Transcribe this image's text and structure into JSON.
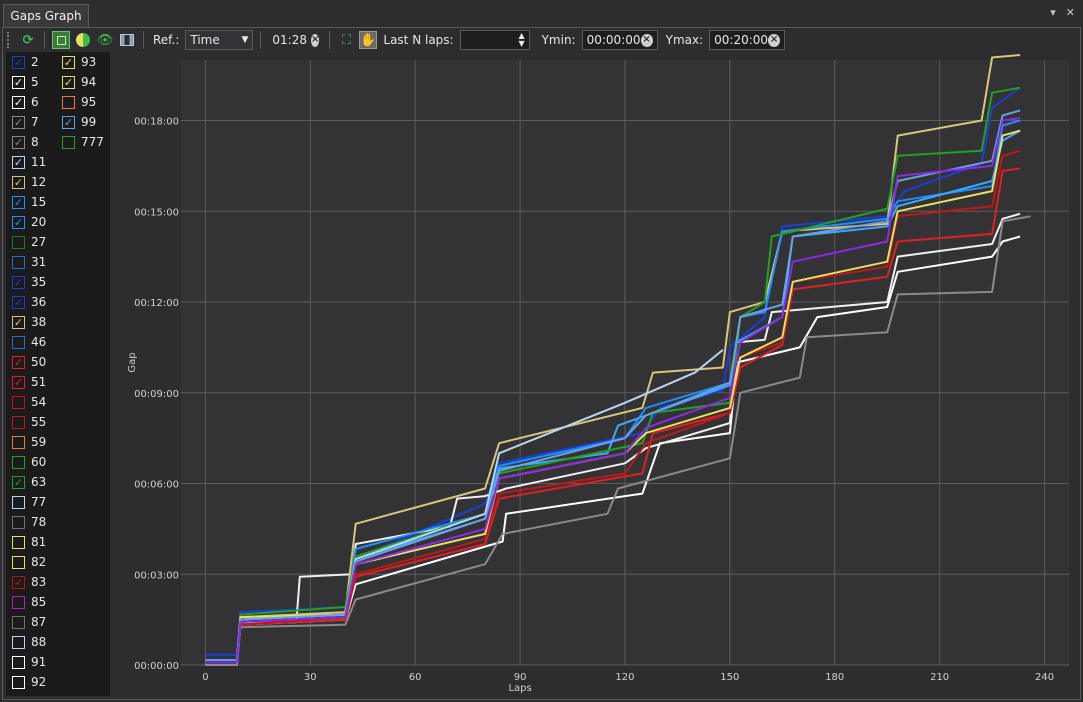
{
  "tab": {
    "title": "Gaps Graph"
  },
  "toolbar": {
    "ref_label": "Ref.:",
    "ref_value": "Time",
    "time_value": "01:28",
    "lastn_label": "Last N laps:",
    "lastn_value": "",
    "ymin_label": "Ymin:",
    "ymin_value": "00:00:00",
    "ymax_label": "Ymax:",
    "ymax_value": "00:20:00"
  },
  "drivers_col1": [
    {
      "num": "2",
      "color": "#1a3fd6",
      "checked": true
    },
    {
      "num": "5",
      "color": "#ffffff",
      "checked": true
    },
    {
      "num": "6",
      "color": "#ffffff",
      "checked": true
    },
    {
      "num": "7",
      "color": "#8a8a8a",
      "checked": true
    },
    {
      "num": "8",
      "color": "#8a8a8a",
      "checked": true
    },
    {
      "num": "11",
      "color": "#b9d6f2",
      "checked": true
    },
    {
      "num": "12",
      "color": "#d9c67a",
      "checked": true
    },
    {
      "num": "15",
      "color": "#1e90ff",
      "checked": true
    },
    {
      "num": "20",
      "color": "#1e90ff",
      "checked": true
    },
    {
      "num": "27",
      "color": "#1e7a1e",
      "checked": false
    },
    {
      "num": "31",
      "color": "#1e6fd0",
      "checked": false
    },
    {
      "num": "35",
      "color": "#1a3fd6",
      "checked": true
    },
    {
      "num": "36",
      "color": "#1a3fd6",
      "checked": true
    },
    {
      "num": "38",
      "color": "#d9c67a",
      "checked": true
    },
    {
      "num": "46",
      "color": "#1e6fd0",
      "checked": false
    },
    {
      "num": "50",
      "color": "#e02020",
      "checked": true
    },
    {
      "num": "51",
      "color": "#e02020",
      "checked": true
    },
    {
      "num": "54",
      "color": "#c01818",
      "checked": false
    },
    {
      "num": "55",
      "color": "#c01818",
      "checked": false
    },
    {
      "num": "59",
      "color": "#e87a3a",
      "checked": false
    },
    {
      "num": "60",
      "color": "#22a022",
      "checked": false
    },
    {
      "num": "63",
      "color": "#22a022",
      "checked": true
    },
    {
      "num": "77",
      "color": "#b9d6f2",
      "checked": false
    },
    {
      "num": "78",
      "color": "#707070",
      "checked": false
    },
    {
      "num": "81",
      "color": "#e8e060",
      "checked": false
    },
    {
      "num": "82",
      "color": "#e8e060",
      "checked": false
    },
    {
      "num": "83",
      "color": "#b01818",
      "checked": true
    },
    {
      "num": "85",
      "color": "#b020c0",
      "checked": false
    },
    {
      "num": "87",
      "color": "#707070",
      "checked": false
    },
    {
      "num": "88",
      "color": "#b9d6f2",
      "checked": false
    },
    {
      "num": "91",
      "color": "#ffffff",
      "checked": false
    },
    {
      "num": "92",
      "color": "#ffffff",
      "checked": false
    }
  ],
  "drivers_col2": [
    {
      "num": "93",
      "color": "#e8e060",
      "checked": true
    },
    {
      "num": "94",
      "color": "#e8e060",
      "checked": true
    },
    {
      "num": "95",
      "color": "#e87a3a",
      "checked": false
    },
    {
      "num": "99",
      "color": "#6aa0e0",
      "checked": true
    },
    {
      "num": "777",
      "color": "#22a022",
      "checked": false
    }
  ],
  "chart_data": {
    "type": "line",
    "xlabel": "Laps",
    "ylabel": "Gap",
    "xlim": [
      -27,
      247
    ],
    "ylim": [
      0,
      1200
    ],
    "xticks": [
      0,
      30,
      60,
      90,
      120,
      150,
      180,
      210,
      240
    ],
    "yticks": [
      0,
      180,
      360,
      540,
      720,
      900,
      1080
    ],
    "ytick_labels": [
      "00:00:00",
      "00:03:00",
      "00:06:00",
      "00:09:00",
      "00:12:00",
      "00:15:00",
      "00:18:00"
    ],
    "grid": true,
    "series": [
      {
        "color": "#1a3fd6",
        "values": [
          [
            0,
            20
          ],
          [
            9,
            20
          ],
          [
            10,
            105
          ],
          [
            40,
            115
          ],
          [
            43,
            210
          ],
          [
            80,
            320
          ],
          [
            84,
            400
          ],
          [
            125,
            460
          ],
          [
            130,
            510
          ],
          [
            148,
            545
          ],
          [
            150,
            630
          ],
          [
            160,
            690
          ],
          [
            165,
            870
          ],
          [
            195,
            890
          ],
          [
            200,
            940
          ],
          [
            222,
            995
          ],
          [
            225,
            1105
          ],
          [
            233,
            1145
          ]
        ]
      },
      {
        "color": "#ffffff",
        "values": [
          [
            0,
            0
          ],
          [
            9,
            0
          ],
          [
            10,
            80
          ],
          [
            40,
            90
          ],
          [
            43,
            160
          ],
          [
            85,
            245
          ],
          [
            86,
            300
          ],
          [
            125,
            340
          ],
          [
            130,
            440
          ],
          [
            150,
            460
          ],
          [
            152,
            600
          ],
          [
            170,
            630
          ],
          [
            175,
            690
          ],
          [
            195,
            710
          ],
          [
            198,
            780
          ],
          [
            225,
            810
          ],
          [
            228,
            840
          ],
          [
            233,
            850
          ]
        ]
      },
      {
        "color": "#f0f0f0",
        "values": [
          [
            0,
            0
          ],
          [
            9,
            0
          ],
          [
            10,
            85
          ],
          [
            26,
            85
          ],
          [
            27,
            175
          ],
          [
            42,
            180
          ],
          [
            43,
            240
          ],
          [
            70,
            275
          ],
          [
            72,
            330
          ],
          [
            80,
            335
          ],
          [
            86,
            350
          ],
          [
            120,
            400
          ],
          [
            126,
            430
          ],
          [
            150,
            480
          ],
          [
            152,
            640
          ],
          [
            160,
            645
          ],
          [
            162,
            700
          ],
          [
            195,
            720
          ],
          [
            198,
            810
          ],
          [
            225,
            835
          ],
          [
            228,
            885
          ],
          [
            233,
            895
          ]
        ]
      },
      {
        "color": "#8a8a8a",
        "values": [
          [
            0,
            0
          ],
          [
            9,
            0
          ],
          [
            10,
            75
          ],
          [
            40,
            80
          ],
          [
            43,
            130
          ],
          [
            80,
            200
          ],
          [
            85,
            260
          ],
          [
            115,
            300
          ],
          [
            118,
            350
          ],
          [
            150,
            410
          ],
          [
            153,
            540
          ],
          [
            170,
            570
          ],
          [
            172,
            650
          ],
          [
            195,
            660
          ],
          [
            198,
            735
          ],
          [
            225,
            740
          ],
          [
            228,
            880
          ],
          [
            236,
            890
          ]
        ]
      },
      {
        "color": "#d9c67a",
        "values": [
          [
            0,
            5
          ],
          [
            9,
            5
          ],
          [
            10,
            95
          ],
          [
            40,
            105
          ],
          [
            43,
            280
          ],
          [
            80,
            350
          ],
          [
            84,
            440
          ],
          [
            125,
            510
          ],
          [
            128,
            580
          ],
          [
            148,
            590
          ],
          [
            150,
            700
          ],
          [
            160,
            720
          ],
          [
            165,
            860
          ],
          [
            195,
            875
          ],
          [
            198,
            1050
          ],
          [
            222,
            1080
          ],
          [
            225,
            1205
          ],
          [
            233,
            1210
          ]
        ]
      },
      {
        "color": "#1e90ff",
        "values": [
          [
            0,
            10
          ],
          [
            9,
            10
          ],
          [
            10,
            95
          ],
          [
            40,
            100
          ],
          [
            43,
            230
          ],
          [
            80,
            300
          ],
          [
            84,
            395
          ],
          [
            120,
            450
          ],
          [
            126,
            510
          ],
          [
            150,
            560
          ],
          [
            153,
            690
          ],
          [
            160,
            700
          ],
          [
            165,
            860
          ],
          [
            195,
            885
          ],
          [
            198,
            920
          ],
          [
            225,
            950
          ],
          [
            228,
            1070
          ],
          [
            233,
            1080
          ]
        ]
      },
      {
        "color": "#3ea8ff",
        "values": [
          [
            0,
            10
          ],
          [
            9,
            10
          ],
          [
            10,
            90
          ],
          [
            40,
            100
          ],
          [
            43,
            210
          ],
          [
            80,
            290
          ],
          [
            84,
            390
          ],
          [
            115,
            420
          ],
          [
            118,
            475
          ],
          [
            150,
            555
          ],
          [
            152,
            640
          ],
          [
            165,
            690
          ],
          [
            168,
            850
          ],
          [
            195,
            870
          ],
          [
            198,
            910
          ],
          [
            225,
            960
          ],
          [
            228,
            1040
          ],
          [
            233,
            1060
          ]
        ]
      },
      {
        "color": "#e02020",
        "values": [
          [
            0,
            5
          ],
          [
            9,
            5
          ],
          [
            10,
            80
          ],
          [
            40,
            90
          ],
          [
            43,
            175
          ],
          [
            80,
            240
          ],
          [
            84,
            330
          ],
          [
            125,
            380
          ],
          [
            128,
            460
          ],
          [
            150,
            500
          ],
          [
            153,
            590
          ],
          [
            165,
            635
          ],
          [
            168,
            745
          ],
          [
            195,
            770
          ],
          [
            198,
            840
          ],
          [
            225,
            855
          ],
          [
            228,
            980
          ],
          [
            233,
            985
          ]
        ]
      },
      {
        "color": "#c01818",
        "values": [
          [
            0,
            5
          ],
          [
            9,
            5
          ],
          [
            10,
            80
          ],
          [
            40,
            95
          ],
          [
            43,
            180
          ],
          [
            80,
            250
          ],
          [
            84,
            340
          ],
          [
            120,
            380
          ],
          [
            126,
            440
          ],
          [
            150,
            500
          ],
          [
            153,
            610
          ],
          [
            165,
            640
          ],
          [
            168,
            760
          ],
          [
            195,
            790
          ],
          [
            198,
            890
          ],
          [
            225,
            910
          ],
          [
            228,
            1010
          ],
          [
            233,
            1020
          ]
        ]
      },
      {
        "color": "#22a022",
        "values": [
          [
            0,
            5
          ],
          [
            9,
            5
          ],
          [
            10,
            100
          ],
          [
            40,
            115
          ],
          [
            43,
            215
          ],
          [
            80,
            300
          ],
          [
            84,
            380
          ],
          [
            125,
            440
          ],
          [
            128,
            500
          ],
          [
            150,
            520
          ],
          [
            153,
            690
          ],
          [
            160,
            720
          ],
          [
            162,
            850
          ],
          [
            195,
            905
          ],
          [
            198,
            1010
          ],
          [
            222,
            1020
          ],
          [
            225,
            1135
          ],
          [
            233,
            1145
          ]
        ]
      },
      {
        "color": "#e8e060",
        "values": [
          [
            0,
            5
          ],
          [
            9,
            5
          ],
          [
            10,
            95
          ],
          [
            40,
            100
          ],
          [
            43,
            200
          ],
          [
            80,
            260
          ],
          [
            84,
            370
          ],
          [
            120,
            420
          ],
          [
            126,
            460
          ],
          [
            150,
            510
          ],
          [
            153,
            610
          ],
          [
            165,
            650
          ],
          [
            168,
            760
          ],
          [
            195,
            800
          ],
          [
            198,
            900
          ],
          [
            225,
            940
          ],
          [
            228,
            1050
          ],
          [
            233,
            1060
          ]
        ]
      },
      {
        "color": "#b9d6f2",
        "values": [
          [
            0,
            5
          ],
          [
            9,
            5
          ],
          [
            10,
            90
          ],
          [
            40,
            100
          ],
          [
            43,
            210
          ],
          [
            80,
            300
          ],
          [
            84,
            420
          ],
          [
            120,
            520
          ],
          [
            140,
            580
          ],
          [
            148,
            625
          ]
        ]
      },
      {
        "color": "#6aa0e0",
        "values": [
          [
            0,
            5
          ],
          [
            9,
            5
          ],
          [
            10,
            90
          ],
          [
            40,
            100
          ],
          [
            43,
            205
          ],
          [
            80,
            290
          ],
          [
            84,
            385
          ],
          [
            120,
            450
          ],
          [
            126,
            495
          ],
          [
            150,
            560
          ],
          [
            153,
            690
          ],
          [
            165,
            715
          ],
          [
            168,
            850
          ],
          [
            195,
            880
          ],
          [
            198,
            960
          ],
          [
            225,
            1000
          ],
          [
            228,
            1090
          ],
          [
            233,
            1100
          ]
        ]
      },
      {
        "color": "#8a2be2",
        "values": [
          [
            0,
            5
          ],
          [
            9,
            5
          ],
          [
            10,
            85
          ],
          [
            40,
            95
          ],
          [
            43,
            200
          ],
          [
            80,
            270
          ],
          [
            84,
            370
          ],
          [
            120,
            420
          ],
          [
            126,
            470
          ],
          [
            150,
            530
          ],
          [
            153,
            640
          ],
          [
            165,
            690
          ],
          [
            168,
            800
          ],
          [
            195,
            840
          ],
          [
            198,
            970
          ],
          [
            225,
            990
          ],
          [
            228,
            1080
          ],
          [
            233,
            1085
          ]
        ]
      }
    ]
  }
}
